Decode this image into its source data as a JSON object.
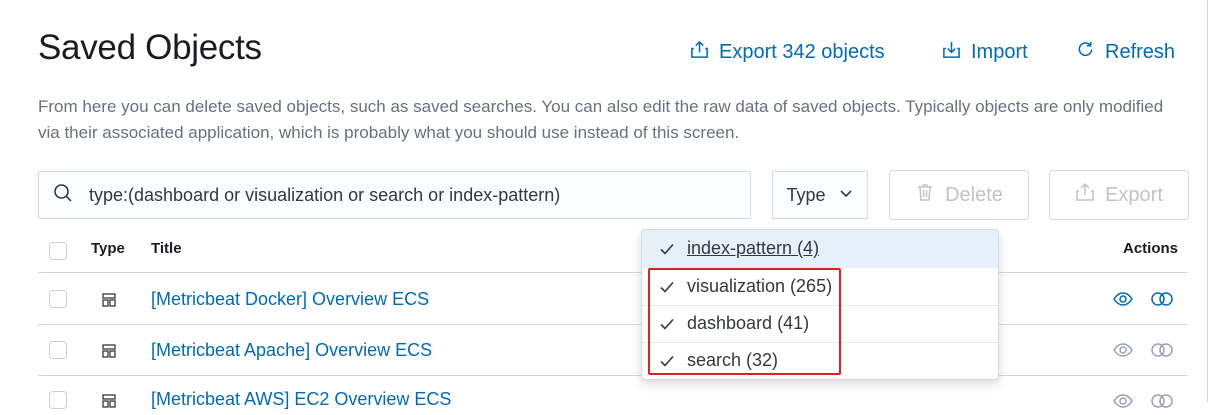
{
  "header": {
    "title": "Saved Objects",
    "export_label": "Export 342 objects",
    "import_label": "Import",
    "refresh_label": "Refresh"
  },
  "description": "From here you can delete saved objects, such as saved searches. You can also edit the raw data of saved objects. Typically objects are only modified via their associated application, which is probably what you should use instead of this screen.",
  "toolbar": {
    "search_value": "type:(dashboard or visualization or search or index-pattern)",
    "type_label": "Type",
    "delete_label": "Delete",
    "export_label": "Export"
  },
  "table": {
    "columns": {
      "type": "Type",
      "title": "Title",
      "actions": "Actions"
    },
    "rows": [
      {
        "title": "[Metricbeat Docker] Overview ECS",
        "icon": "visualization-icon"
      },
      {
        "title": "[Metricbeat Apache] Overview ECS",
        "icon": "visualization-icon"
      },
      {
        "title": "[Metricbeat AWS] EC2 Overview ECS",
        "icon": "visualization-icon"
      }
    ]
  },
  "type_dropdown": {
    "items": [
      {
        "label": "index-pattern (4)",
        "checked": true,
        "active": true
      },
      {
        "label": "visualization (265)",
        "checked": true
      },
      {
        "label": "dashboard (41)",
        "checked": true
      },
      {
        "label": "search (32)",
        "checked": true
      }
    ]
  },
  "colors": {
    "link": "#006bb4",
    "text": "#343741",
    "border": "#d3dae6",
    "highlight": "#e02020",
    "active_row": "#e6f0f8"
  }
}
